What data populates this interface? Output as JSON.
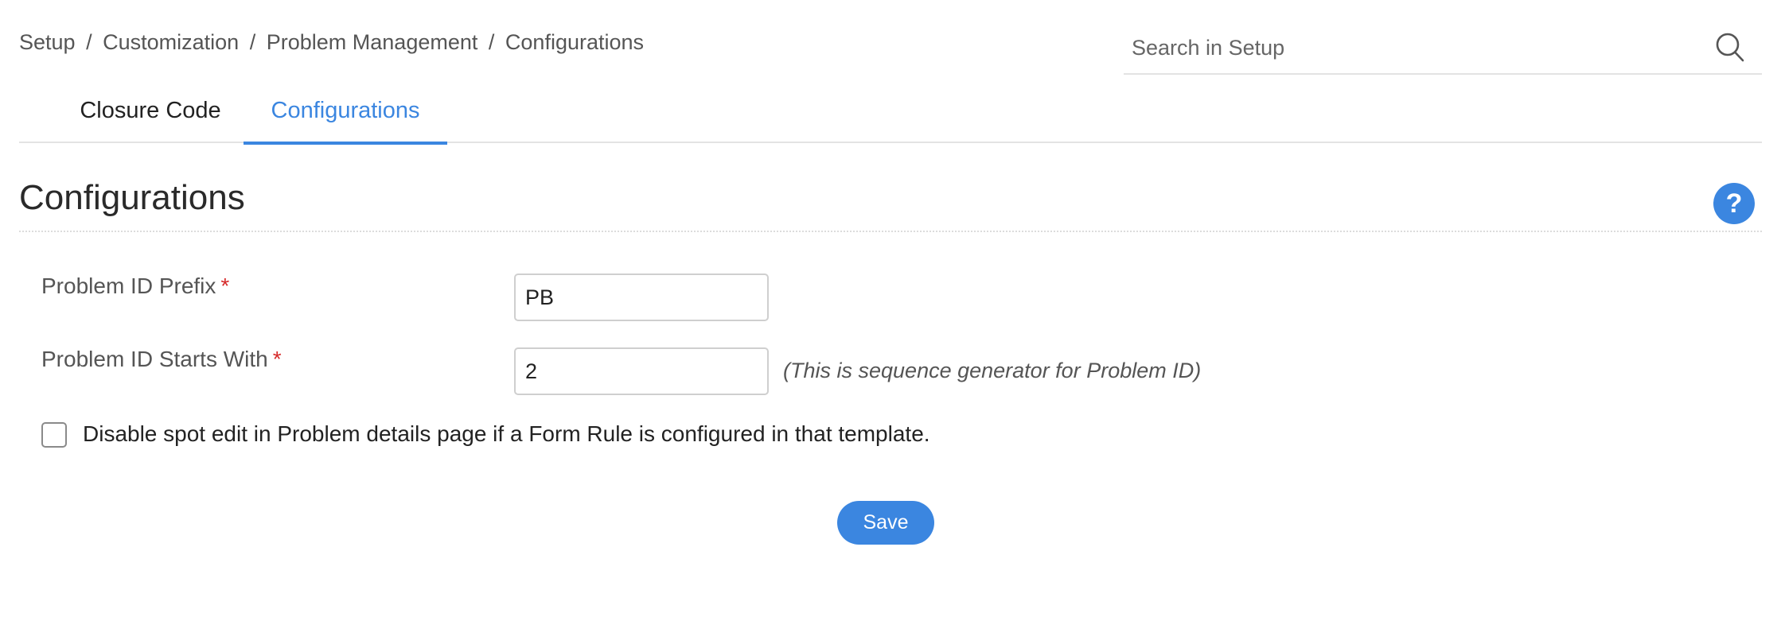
{
  "breadcrumb": {
    "items": [
      "Setup",
      "Customization",
      "Problem Management",
      "Configurations"
    ],
    "separator": "/"
  },
  "search": {
    "placeholder": "Search in Setup",
    "value": "",
    "icon": "search-icon"
  },
  "tabs": [
    {
      "label": "Closure Code",
      "active": false
    },
    {
      "label": "Configurations",
      "active": true
    }
  ],
  "section": {
    "title": "Configurations",
    "help_icon": "?"
  },
  "form": {
    "prefix": {
      "label": "Problem ID Prefix",
      "required_mark": "*",
      "value": "PB"
    },
    "starts_with": {
      "label": "Problem ID Starts With",
      "required_mark": "*",
      "value": "2",
      "hint": "(This is sequence generator for Problem ID)"
    },
    "disable_spot_edit": {
      "label": "Disable spot edit in Problem details page if a Form Rule is configured in that template.",
      "checked": false
    },
    "save_label": "Save"
  },
  "colors": {
    "accent": "#3b86e0",
    "required": "#d62b2b",
    "text": "#333333",
    "muted": "#555555",
    "border": "#e3e3e3"
  }
}
